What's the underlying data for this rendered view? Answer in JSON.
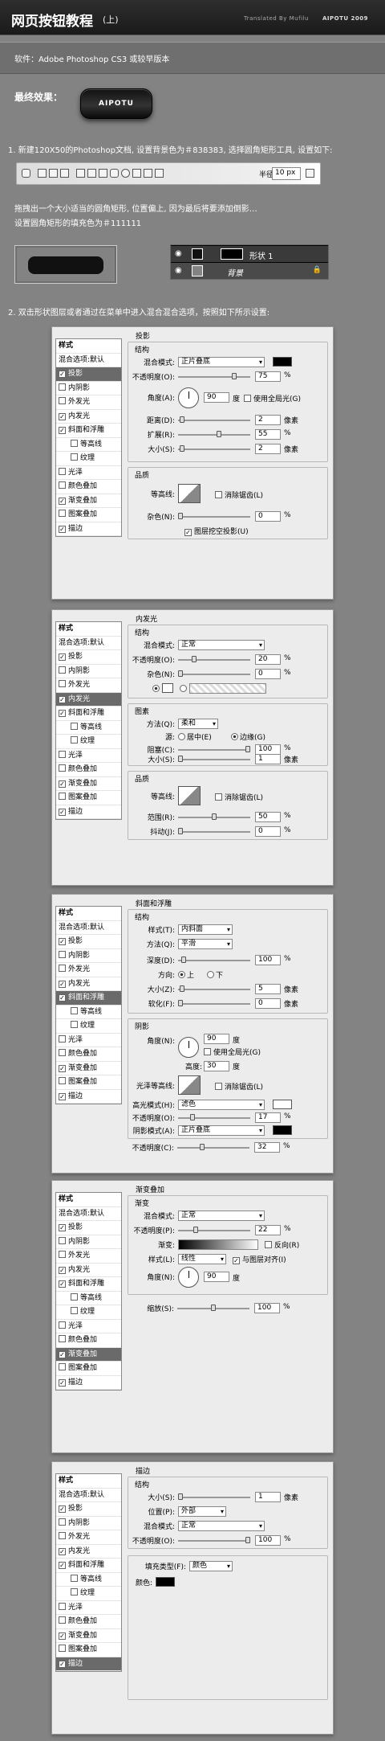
{
  "header": {
    "title": "网页按钮教程",
    "subtitle": "(上)",
    "credit": "Translated By Mufilu",
    "brand": "AIPOTU 2009"
  },
  "software": "软件：Adobe Photoshop CS3 或较早版本",
  "final": {
    "label": "最终效果：",
    "button_text": "AIPOTU"
  },
  "step1": {
    "text": "1. 新建120X50的Photoshop文档, 设置背景色为＃838383, 选择圆角矩形工具, 设置如下:",
    "radius_label": "半径:",
    "radius_value": "10 px",
    "para1": "拖拽出一个大小适当的圆角矩形, 位置偏上, 因为最后将要添加倒影…",
    "para2": "设置圆角矩形的填充色为＃111111"
  },
  "layers": {
    "shape_name": "形状 1",
    "bg_name": "背景"
  },
  "step2": {
    "text": "2. 双击形状图层或者通过在菜单中进入混合混合选项，按照如下所示设置:"
  },
  "sidebar": {
    "title": "样式",
    "items": [
      "混合选项:默认",
      "投影",
      "内阴影",
      "外发光",
      "内发光",
      "斜面和浮雕",
      "等高线",
      "纹理",
      "光泽",
      "颜色叠加",
      "渐变叠加",
      "图案叠加",
      "描边"
    ]
  },
  "panel1": {
    "title": "投影",
    "structure": "结构",
    "blend_label": "混合模式:",
    "blend_value": "正片叠底",
    "opacity_label": "不透明度(O):",
    "opacity_value": "75",
    "angle_label": "角度(A):",
    "angle_value": "90",
    "degree": "度",
    "global_light": "使用全局光(G)",
    "distance_label": "距离(D):",
    "distance_value": "2",
    "spread_label": "扩展(R):",
    "spread_value": "55",
    "size_label": "大小(S):",
    "size_value": "2",
    "quality": "品质",
    "contour_label": "等高线:",
    "antialias": "消除锯齿(L)",
    "noise_label": "杂色(N):",
    "noise_value": "0",
    "knockout": "图层挖空投影(U)",
    "pct": "%",
    "px": "像素",
    "shadow_color": "#000000",
    "selected_index": 1
  },
  "panel2": {
    "title": "内发光",
    "structure": "结构",
    "blend_label": "混合模式:",
    "blend_value": "正常",
    "opacity_label": "不透明度(O):",
    "opacity_value": "20",
    "noise_label": "杂色(N):",
    "noise_value": "0",
    "elements": "图素",
    "method_label": "方法(Q):",
    "method_value": "柔和",
    "source_label": "源:",
    "center": "居中(E)",
    "edge": "边缘(G)",
    "choke_label": "阻塞(C):",
    "choke_value": "100",
    "size_label": "大小(S):",
    "size_value": "1",
    "quality": "品质",
    "contour_label": "等高线:",
    "antialias": "消除锯齿(L)",
    "range_label": "范围(R):",
    "range_value": "50",
    "jitter_label": "抖动(J):",
    "jitter_value": "0",
    "pct": "%",
    "px": "像素",
    "selected_index": 4
  },
  "panel3": {
    "title": "斜面和浮雕",
    "structure": "结构",
    "style_label": "样式(T):",
    "style_value": "内斜面",
    "technique_label": "方法(Q):",
    "technique_value": "平滑",
    "depth_label": "深度(D):",
    "depth_value": "100",
    "direction_label": "方向:",
    "up": "上",
    "down": "下",
    "size_label": "大小(Z):",
    "size_value": "5",
    "soften_label": "软化(F):",
    "soften_value": "0",
    "shading": "阴影",
    "angle_label": "角度(N):",
    "angle_value": "90",
    "degree": "度",
    "global_light": "使用全局光(G)",
    "altitude_label": "高度:",
    "altitude_value": "30",
    "gloss_label": "光泽等高线:",
    "antialias": "消除锯齿(L)",
    "highlight_label": "高光模式(H):",
    "highlight_value": "滤色",
    "hl_opacity_label": "不透明度(O):",
    "hl_opacity_value": "17",
    "shadow_label": "阴影模式(A):",
    "shadow_value": "正片叠底",
    "sh_opacity_label": "不透明度(C):",
    "sh_opacity_value": "32",
    "pct": "%",
    "px": "像素",
    "selected_index": 5
  },
  "panel4": {
    "title": "渐变叠加",
    "gradient": "渐变",
    "blend_label": "混合模式:",
    "blend_value": "正常",
    "opacity_label": "不透明度(P):",
    "opacity_value": "22",
    "gradient_label": "渐变:",
    "reverse": "反向(R)",
    "style_label": "样式(L):",
    "style_value": "线性",
    "align": "与图层对齐(I)",
    "angle_label": "角度(N):",
    "angle_value": "90",
    "degree": "度",
    "scale_label": "缩放(S):",
    "scale_value": "100",
    "pct": "%",
    "selected_index": 10
  },
  "panel5": {
    "title": "描边",
    "structure": "结构",
    "size_label": "大小(S):",
    "size_value": "1",
    "position_label": "位置(P):",
    "position_value": "外部",
    "blend_label": "混合模式:",
    "blend_value": "正常",
    "opacity_label": "不透明度(O):",
    "opacity_value": "100",
    "fill_label": "填充类型(F):",
    "fill_value": "颜色",
    "color_label": "颜色:",
    "pct": "%",
    "px": "像素",
    "stroke_color": "#000000",
    "selected_index": 12
  }
}
